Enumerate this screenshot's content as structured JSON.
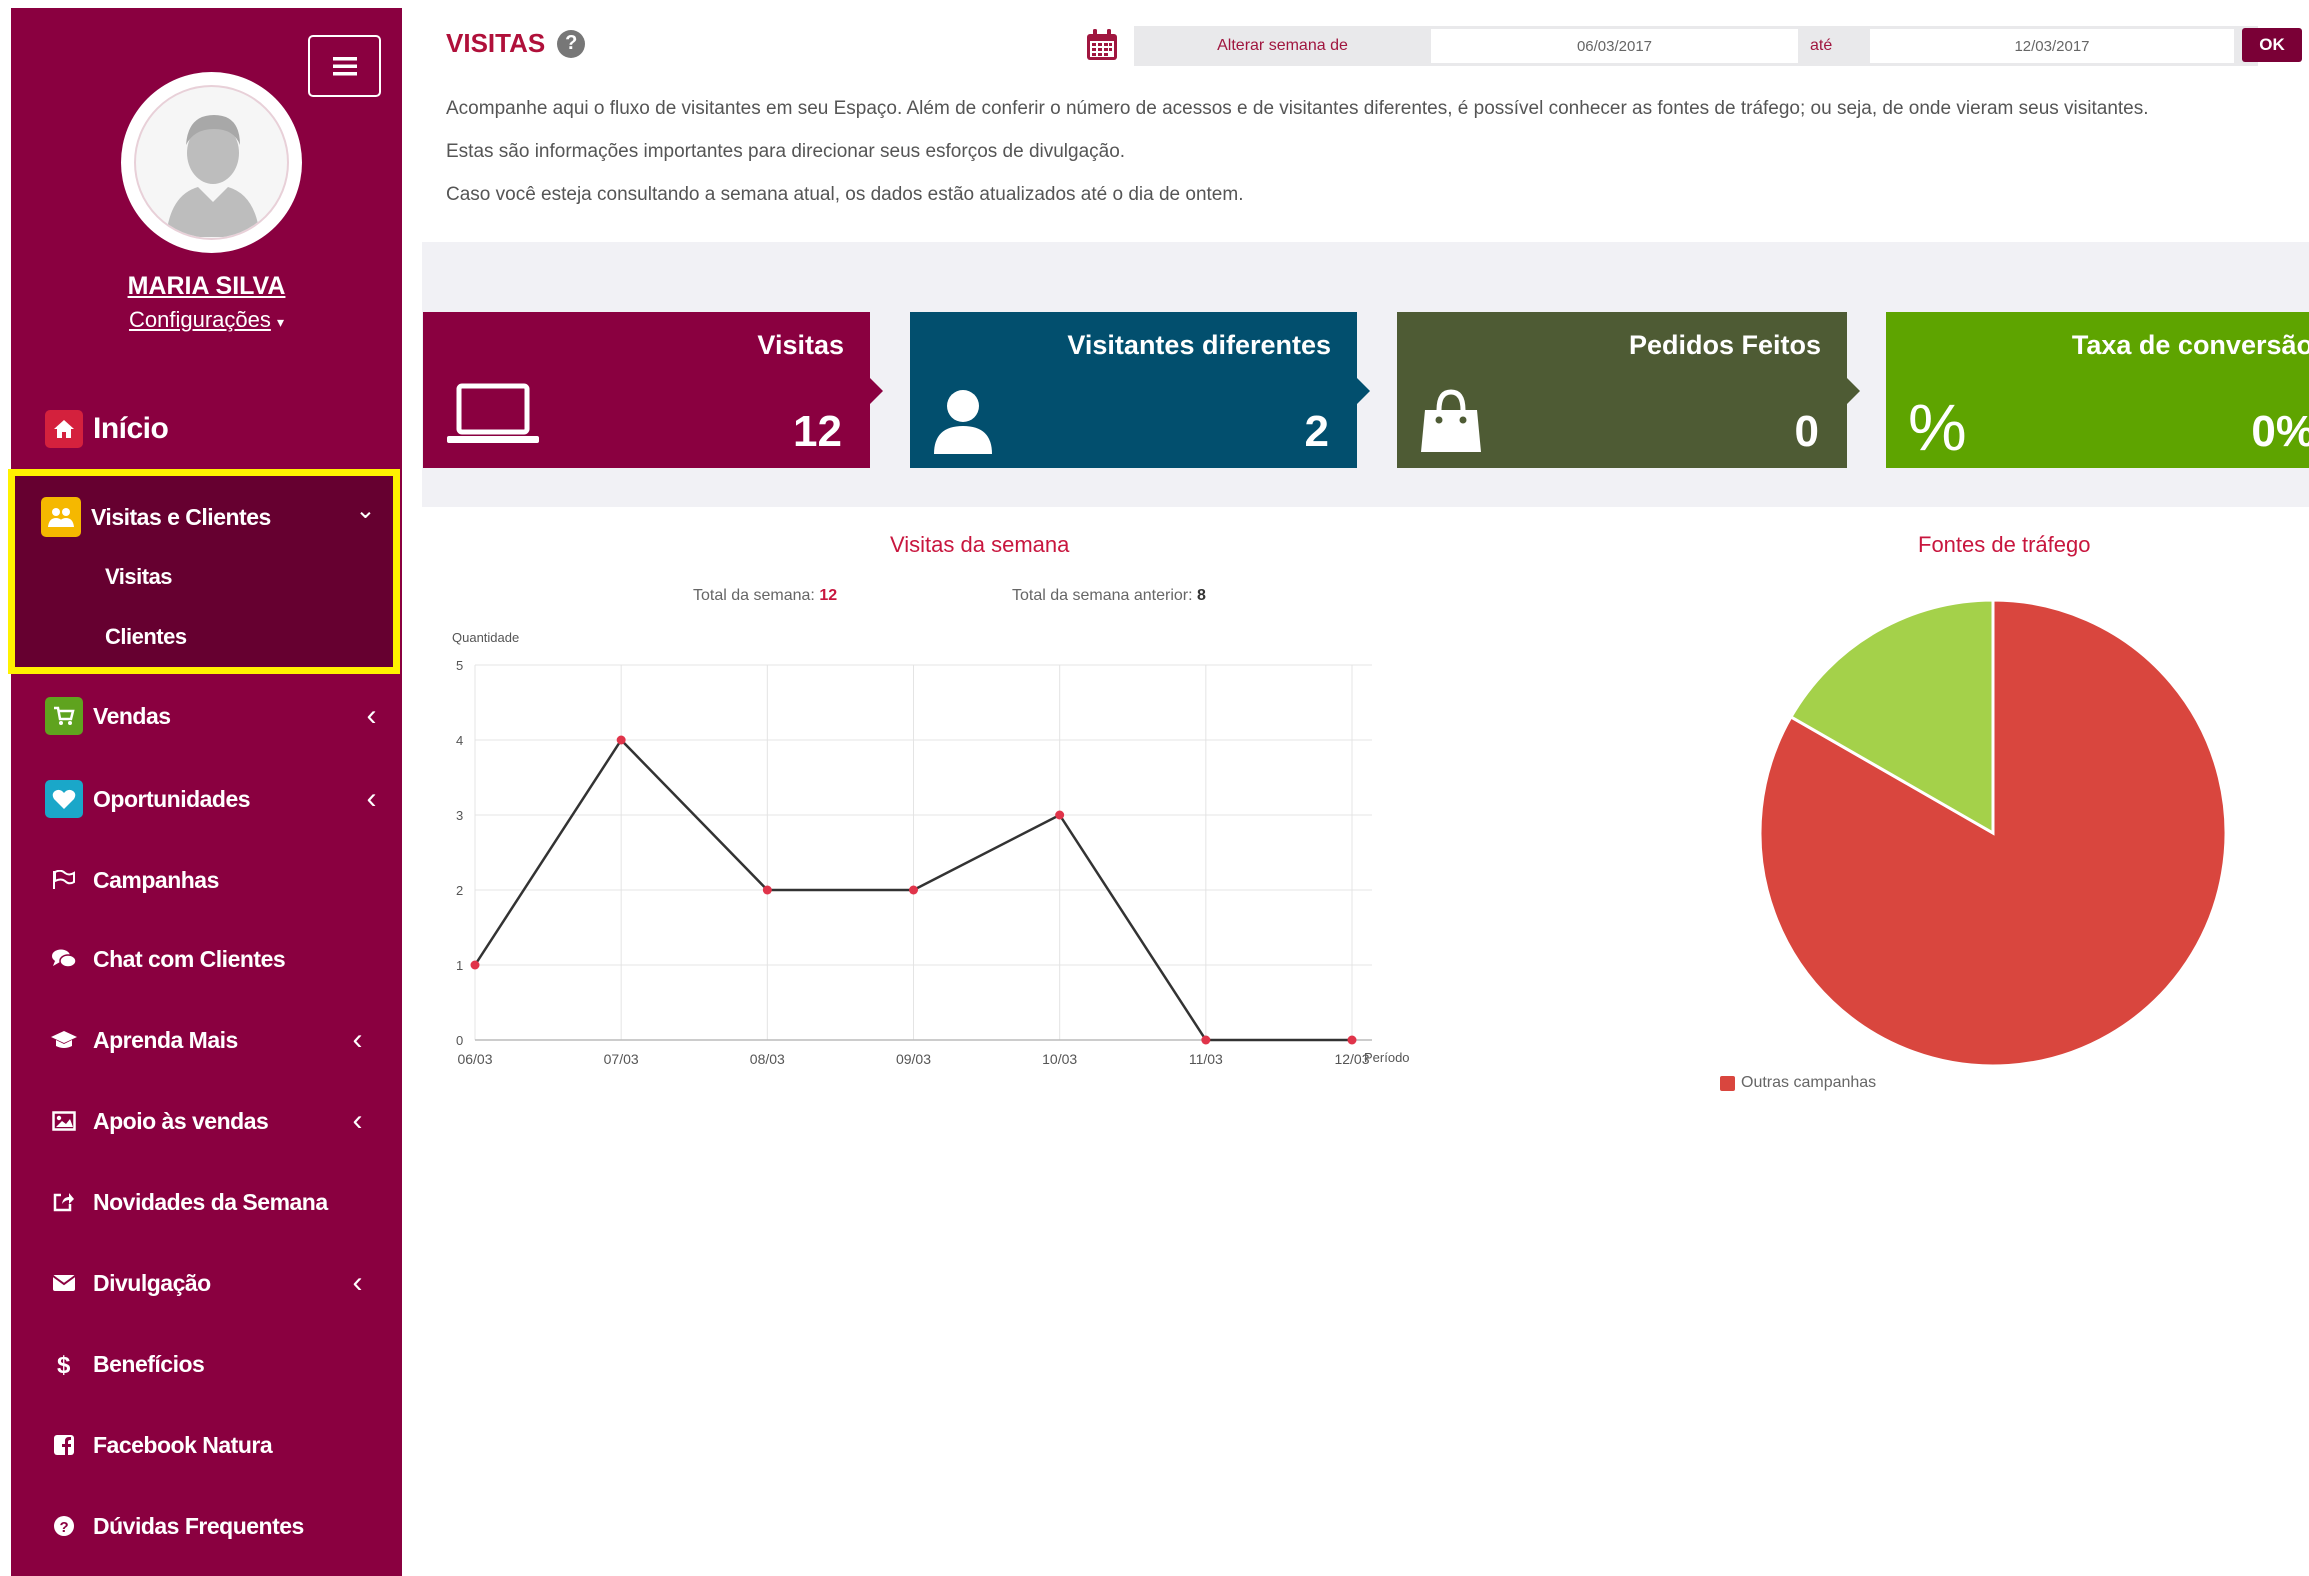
{
  "sidebar": {
    "user_name": "MARIA SILVA",
    "config_label": "Configurações",
    "config_caret": "▾",
    "home_label": "Início",
    "group": {
      "label": "Visitas e Clientes",
      "sub_items": [
        "Visitas",
        "Clientes"
      ]
    },
    "items": [
      {
        "label": "Vendas",
        "icon": "cart-icon"
      },
      {
        "label": "Oportunidades",
        "icon": "heart-icon"
      },
      {
        "label": "Campanhas",
        "icon": "flag-icon"
      },
      {
        "label": "Chat com Clientes",
        "icon": "chat-icon"
      },
      {
        "label": "Aprenda Mais",
        "icon": "graduation-cap-icon"
      },
      {
        "label": "Apoio às vendas",
        "icon": "picture-icon"
      },
      {
        "label": "Novidades da Semana",
        "icon": "share-icon"
      },
      {
        "label": "Divulgação",
        "icon": "envelope-icon"
      },
      {
        "label": "Benefícios",
        "icon": "dollar-icon"
      },
      {
        "label": "Facebook Natura",
        "icon": "facebook-icon"
      },
      {
        "label": "Dúvidas Frequentes",
        "icon": "question-icon"
      }
    ],
    "chevron_down": "⌄",
    "chevron_left": "‹"
  },
  "header": {
    "title": "VISITAS",
    "help": "?",
    "week_label": "Alterar semana de",
    "date_from": "06/03/2017",
    "to_label": "até",
    "date_to": "12/03/2017",
    "ok_label": "OK"
  },
  "description": [
    "Acompanhe aqui o fluxo de visitantes em seu Espaço. Além de conferir o número de acessos e de visitantes diferentes, é possível conhecer as fontes de tráfego; ou seja, de onde vieram seus visitantes.",
    "Estas são informações importantes para direcionar seus esforços de divulgação.",
    "Caso você esteja consultando a semana atual, os dados estão atualizados até o dia de ontem."
  ],
  "cards": [
    {
      "title": "Visitas",
      "value": "12",
      "color": "#8a0040",
      "icon": "laptop-icon"
    },
    {
      "title": "Visitantes diferentes",
      "value": "2",
      "color": "#024f6e",
      "icon": "user-icon"
    },
    {
      "title": "Pedidos Feitos",
      "value": "0",
      "color": "#4e5b34",
      "icon": "shopping-bag-icon"
    },
    {
      "title": "Taxa de conversão",
      "value": "0%",
      "color": "#5ea400",
      "icon": "percent-icon"
    }
  ],
  "line_chart": {
    "title": "Visitas da semana",
    "total_label": "Total da semana:",
    "total_value": "12",
    "prev_label": "Total da semana anterior:",
    "prev_value": "8"
  },
  "pie_chart": {
    "title": "Fontes de tráfego",
    "legend_label": "Outras campanhas"
  },
  "chart_data": [
    {
      "type": "line",
      "title": "Visitas da semana",
      "xlabel": "Período",
      "ylabel": "Quantidade",
      "categories": [
        "06/03",
        "07/03",
        "08/03",
        "09/03",
        "10/03",
        "11/03",
        "12/03"
      ],
      "values": [
        1,
        4,
        2,
        2,
        3,
        0,
        0
      ],
      "ylim": [
        0,
        5
      ],
      "yticks": [
        "0",
        "1",
        "2",
        "3",
        "4",
        "5"
      ],
      "grid": true,
      "line_color": "#333333",
      "point_color": "#e0344a"
    },
    {
      "type": "pie",
      "title": "Fontes de tráfego",
      "slices": [
        {
          "label": "Outras campanhas",
          "value": 83.3,
          "color": "#d9463e"
        },
        {
          "label": "",
          "value": 16.7,
          "color": "#a4d14a"
        }
      ],
      "legend": "bottom-left"
    }
  ]
}
